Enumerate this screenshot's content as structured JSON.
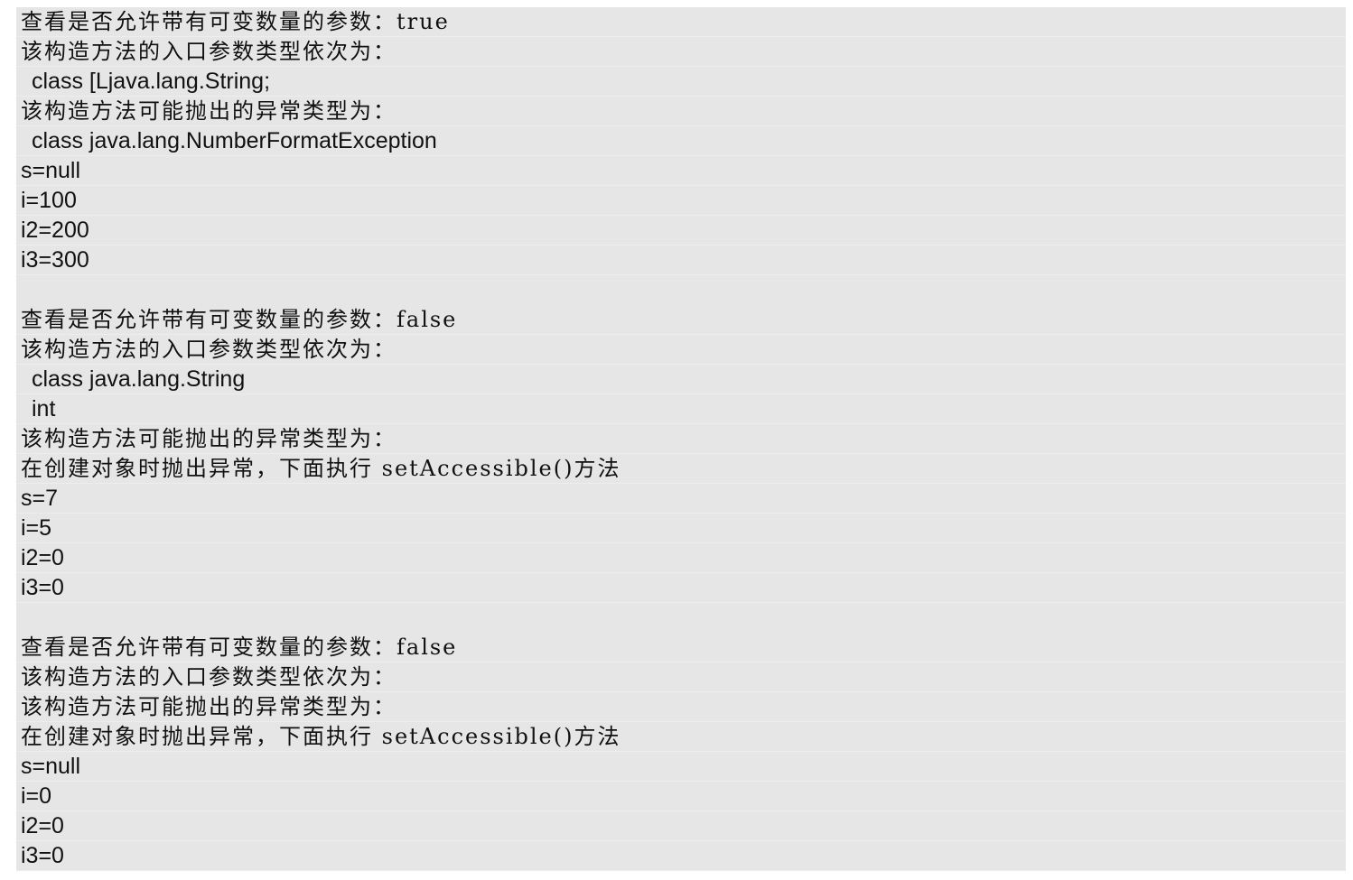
{
  "console": {
    "lines": [
      "查看是否允许带有可变数量的参数：true",
      "该构造方法的入口参数类型依次为：",
      "class [Ljava.lang.String;",
      "该构造方法可能抛出的异常类型为：",
      "class java.lang.NumberFormatException",
      "s=null",
      "i=100",
      "i2=200",
      "i3=300",
      "",
      "查看是否允许带有可变数量的参数：false",
      "该构造方法的入口参数类型依次为：",
      "class java.lang.String",
      "int",
      "该构造方法可能抛出的异常类型为：",
      "在创建对象时抛出异常，下面执行 setAccessible()方法",
      "s=7",
      "i=5",
      "i2=0",
      "i3=0",
      "",
      "查看是否允许带有可变数量的参数：false",
      "该构造方法的入口参数类型依次为：",
      "该构造方法可能抛出的异常类型为：",
      "在创建对象时抛出异常，下面执行 setAccessible()方法",
      "s=null",
      "i=0",
      "i2=0",
      "i3=0"
    ]
  }
}
